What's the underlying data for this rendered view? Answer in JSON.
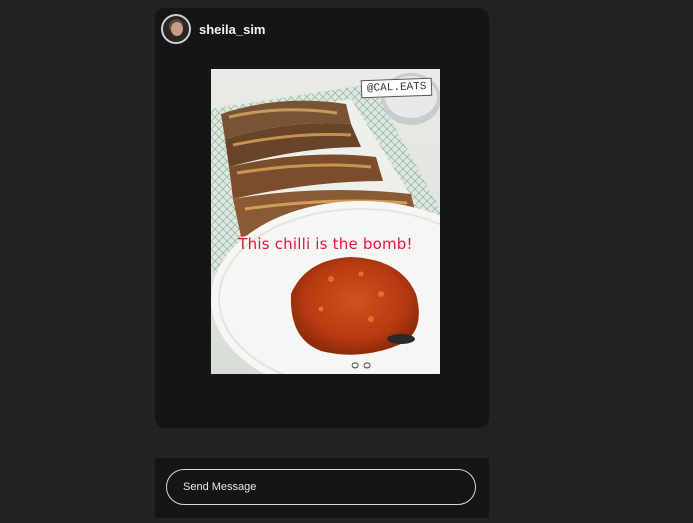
{
  "story": {
    "username": "sheila_sim",
    "photo_tag": "@CAL.EATS",
    "photo_caption": "This chilli is the bomb!"
  },
  "composer": {
    "placeholder": "Send Message"
  },
  "colors": {
    "background": "#222222",
    "panel": "#151515",
    "caption": "#e4163d"
  }
}
